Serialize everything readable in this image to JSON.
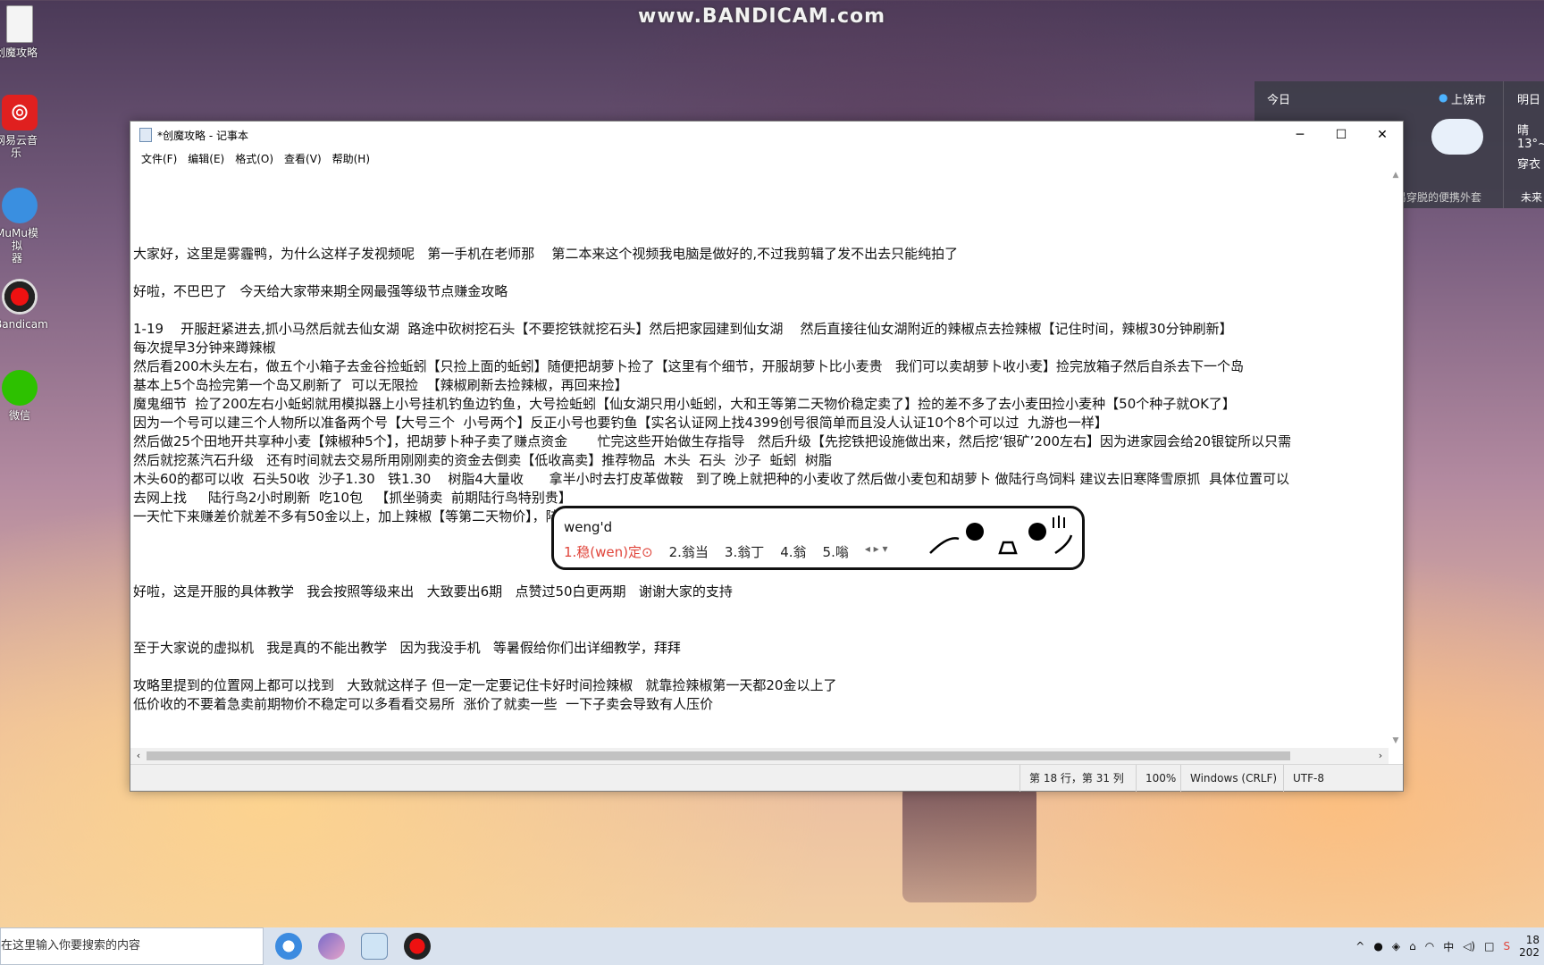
{
  "watermark": "www.BANDICAM.com",
  "desktop_icons": [
    {
      "label": "创魔攻略",
      "icon": "text-file-icon"
    },
    {
      "label": "网易云音乐",
      "icon": "netease-music-icon"
    },
    {
      "label": "MuMu模拟\n器",
      "icon": "mumu-emulator-icon"
    },
    {
      "label": "Bandicam",
      "icon": "bandicam-icon"
    },
    {
      "label": "微信",
      "icon": "wechat-icon"
    }
  ],
  "weather": {
    "today_label": "今日",
    "location": "上饶市",
    "tomorrow_label": "明日",
    "tomorrow_condition": "晴",
    "tomorrow_temp": "13°~",
    "tomorrow_tip": "穿衣",
    "advice": "易穿脱的便携外套",
    "future_label": "未来"
  },
  "window": {
    "title": "*创魔攻略 - 记事本",
    "controls": {
      "minimize": "─",
      "maximize": "☐",
      "close": "✕"
    },
    "menu": [
      "文件(F)",
      "编辑(E)",
      "格式(O)",
      "查看(V)",
      "帮助(H)"
    ],
    "lines": [
      "",
      "",
      "",
      "",
      "大家好，这里是雾霾鸭，为什么这样子发视频呢   第一手机在老师那    第二本来这个视频我电脑是做好的,不过我剪辑了发不出去只能纯拍了",
      "",
      "好啦，不巴巴了   今天给大家带来期全网最强等级节点赚金攻略",
      "",
      "1-19    开服赶紧进去,抓小马然后就去仙女湖  路途中砍树挖石头【不要挖铁就挖石头】然后把家园建到仙女湖    然后直接往仙女湖附近的辣椒点去捡辣椒【记住时间，辣椒30分钟刷新】",
      "每次提早3分钟来蹲辣椒",
      "然后看200木头左右，做五个小箱子去金谷捡蚯蚓【只捡上面的蚯蚓】随便把胡萝卜捡了【这里有个细节，开服胡萝卜比小麦贵   我们可以卖胡萝卜收小麦】捡完放箱子然后自杀去下一个岛",
      "基本上5个岛捡完第一个岛又刷新了  可以无限捡  【辣椒刷新去捡辣椒，再回来捡】",
      "魔鬼细节  捡了200左右小蚯蚓就用模拟器上小号挂机钓鱼边钓鱼，大号捡蚯蚓【仙女湖只用小蚯蚓，大和王等第二天物价稳定卖了】捡的差不多了去小麦田捡小麦种【50个种子就OK了】",
      "因为一个号可以建三个人物所以准备两个号【大号三个  小号两个】反正小号也要钓鱼【实名认证网上找4399创号很简单而且没人认证10个8个可以过  九游也一样】",
      "然后做25个田地开共享种小麦【辣椒种5个】，把胡萝卜种子卖了赚点资金       忙完这些开始做生存指导   然后升级【先挖铁把设施做出来，然后挖‘银矿’200左右】因为进家园会给20银锭所以只需",
      "然后就挖蒸汽石升级   还有时间就去交易所用刚刚卖的资金去倒卖【低收高卖】推荐物品  木头  石头  沙子  蚯蚓  树脂",
      "木头60的都可以收  石头50收  沙子1.30   铁1.30    树脂4大量收      拿半小时去打皮革做鞍   到了晚上就把种的小麦收了然后做小麦包和胡萝卜 做陆行鸟饲料 建议去旧寒降雪原抓  具体位置可以",
      "去网上找     陆行鸟2小时刷新  吃10包   【抓坐骑卖  前期陆行鸟特别贵】",
      "一天忙下来赚差价就差不多有50金以上，加上辣椒【等第二天物价】，陆行鸟，胡萝卜啥的百来金保底",
      "",
      "",
      "",
      "好啦，这是开服的具体教学   我会按照等级来出   大致要出6期   点赞过50白更两期   谢谢大家的支持",
      "",
      "",
      "至于大家说的虚拟机   我是真的不能出教学   因为我没手机   等暑假给你们出详细教学，拜拜",
      "",
      "攻略里提到的位置网上都可以找到   大致就这样子 但一定一定要记住卡好时间捡辣椒   就靠捡辣椒第一天都20金以上了",
      "低价收的不要着急卖前期物价不稳定可以多看看交易所  涨价了就卖一些  一下子卖会导致有人压价"
    ],
    "status": {
      "position": "第 18 行，第 31 列",
      "zoom": "100%",
      "line_ending": "Windows (CRLF)",
      "encoding": "UTF-8"
    }
  },
  "ime": {
    "composition": "weng'd",
    "candidates": [
      "1.稳(wen)定⊙",
      "2.翁当",
      "3.翁丁",
      "4.翁",
      "5.嗡"
    ]
  },
  "taskbar": {
    "search_placeholder": "在这里输入你要搜索的内容",
    "tray_ime": "中",
    "clock_time": "18",
    "clock_date": "202"
  }
}
